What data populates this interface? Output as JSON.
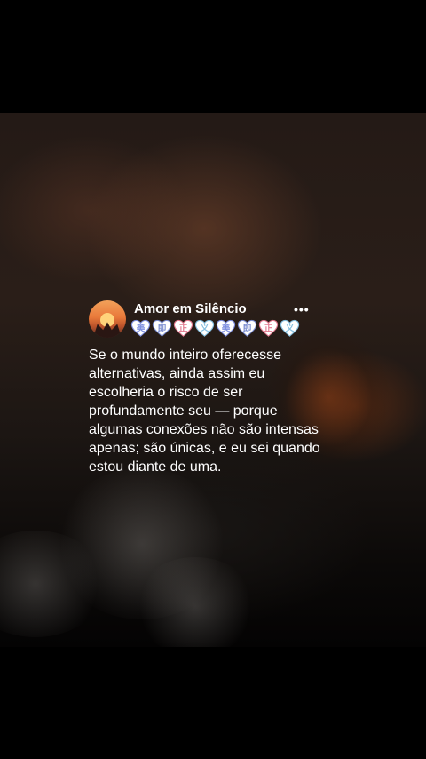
{
  "post": {
    "author_name": "Amor em Silêncio",
    "more_label": "•••",
    "avatar_icon": "sunset-hands-icon",
    "badges": [
      {
        "icon": "heart-glyph-badge-icon",
        "color": "#7e8fe0",
        "glyph": "美"
      },
      {
        "icon": "heart-glyph-badge-icon",
        "color": "#7a8ccf",
        "glyph": "即"
      },
      {
        "icon": "heart-glyph-badge-icon",
        "color": "#e27a8f",
        "glyph": "正"
      },
      {
        "icon": "heart-glyph-badge-icon",
        "color": "#86c0e0",
        "glyph": "义"
      },
      {
        "icon": "heart-glyph-badge-icon",
        "color": "#7e8fe0",
        "glyph": "美"
      },
      {
        "icon": "heart-glyph-badge-icon",
        "color": "#7a8ccf",
        "glyph": "即"
      },
      {
        "icon": "heart-glyph-badge-icon",
        "color": "#e27a8f",
        "glyph": "正"
      },
      {
        "icon": "heart-glyph-badge-icon",
        "color": "#86c0e0",
        "glyph": "义"
      }
    ],
    "text": "Se o mundo inteiro oferecesse\nalternativas, ainda assim eu\nescolheria o risco de ser\nprofundamente seu — porque\nalgumas conexões não são intensas\napenas; são únicas, e eu sei quando\nestou diante de uma."
  },
  "colors": {
    "background": "#000000",
    "text": "#ffffff"
  }
}
